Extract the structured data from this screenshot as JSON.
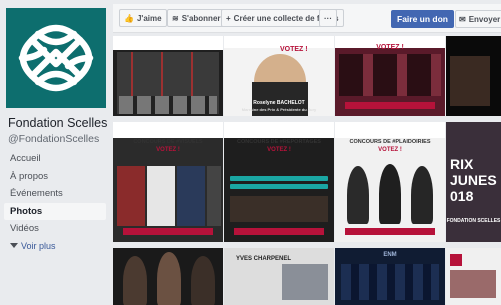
{
  "sidebar": {
    "page_name": "Fondation Scelles",
    "handle": "@FondationScelles",
    "nav": [
      {
        "label": "Accueil"
      },
      {
        "label": "À propos"
      },
      {
        "label": "Événements"
      },
      {
        "label": "Photos"
      },
      {
        "label": "Vidéos"
      }
    ],
    "more": "Voir plus"
  },
  "toolbar": {
    "like": "J'aime",
    "subscribe": "S'abonner",
    "collect": "Créer une collecte de fonds",
    "more": "···",
    "donate": "Faire un don",
    "send": "Envoyer"
  },
  "photos": {
    "p2_title": "VOTEZ !",
    "p2_name": "Roselyne BACHELOT",
    "p2_caption": "Marraine des Prix & Présidente du Jury",
    "p3_title": "VOTEZ !",
    "p4_title": "CONCOURS DE #VISUELS",
    "p4_sub": "VOTEZ !",
    "p5_title": "CONCOURS DE #REPORTAGES",
    "p5_sub": "VOTEZ !",
    "p6_title": "CONCOURS DE #PLAIDOIRIES",
    "p6_sub": "VOTEZ !",
    "p7_title": "RIX JUNES 018",
    "p7_foot": "FONDATION SCELLES",
    "p9_name": "YVES CHARPENEL",
    "p10_logo": "ENM"
  },
  "colors": {
    "accent": "#4267b2",
    "brand": "#0d6e6e"
  }
}
